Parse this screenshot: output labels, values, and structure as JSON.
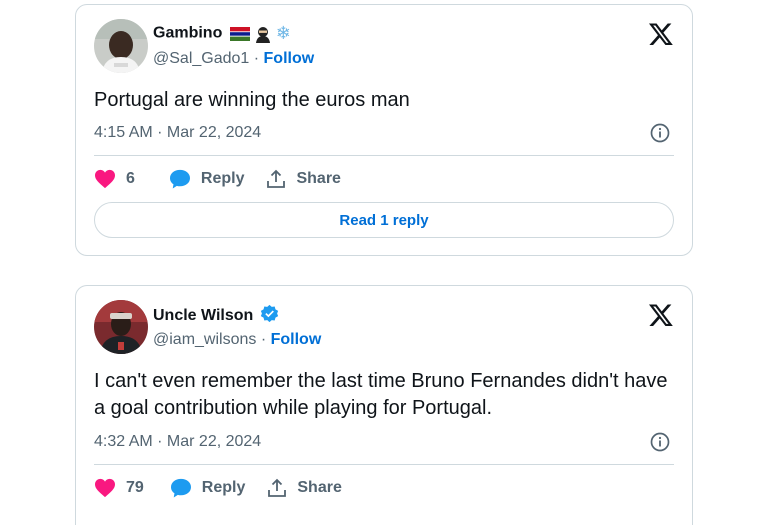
{
  "tweets": [
    {
      "name": "Gambino",
      "name_emojis": "🇬🇲🥷❄️",
      "handle": "@Sal_Gado1",
      "separator": " · ",
      "follow_label": "Follow",
      "text": "Portugal are winning the euros man",
      "timestamp": "4:15 AM · Mar 22, 2024",
      "likes": "6",
      "reply_label": "Reply",
      "share_label": "Share",
      "read_replies_label": "Read 1 reply"
    },
    {
      "name": "Uncle Wilson",
      "verified": true,
      "handle": "@iam_wilsons",
      "separator": " · ",
      "follow_label": "Follow",
      "text": "I can't even remember the last time Bruno Fernandes didn't have a goal contribution while playing for Portugal.",
      "timestamp": "4:32 AM · Mar 22, 2024",
      "likes": "79",
      "reply_label": "Reply",
      "share_label": "Share"
    }
  ],
  "colors": {
    "like": "#f91880",
    "reply": "#1d9bf0",
    "link": "#006fd6",
    "muted": "#536471",
    "border": "#cfd9de",
    "verified": "#1d9bf0"
  },
  "icons": [
    "x-logo-icon",
    "info-icon",
    "heart-icon",
    "reply-bubble-icon",
    "share-icon",
    "verified-badge-icon"
  ]
}
